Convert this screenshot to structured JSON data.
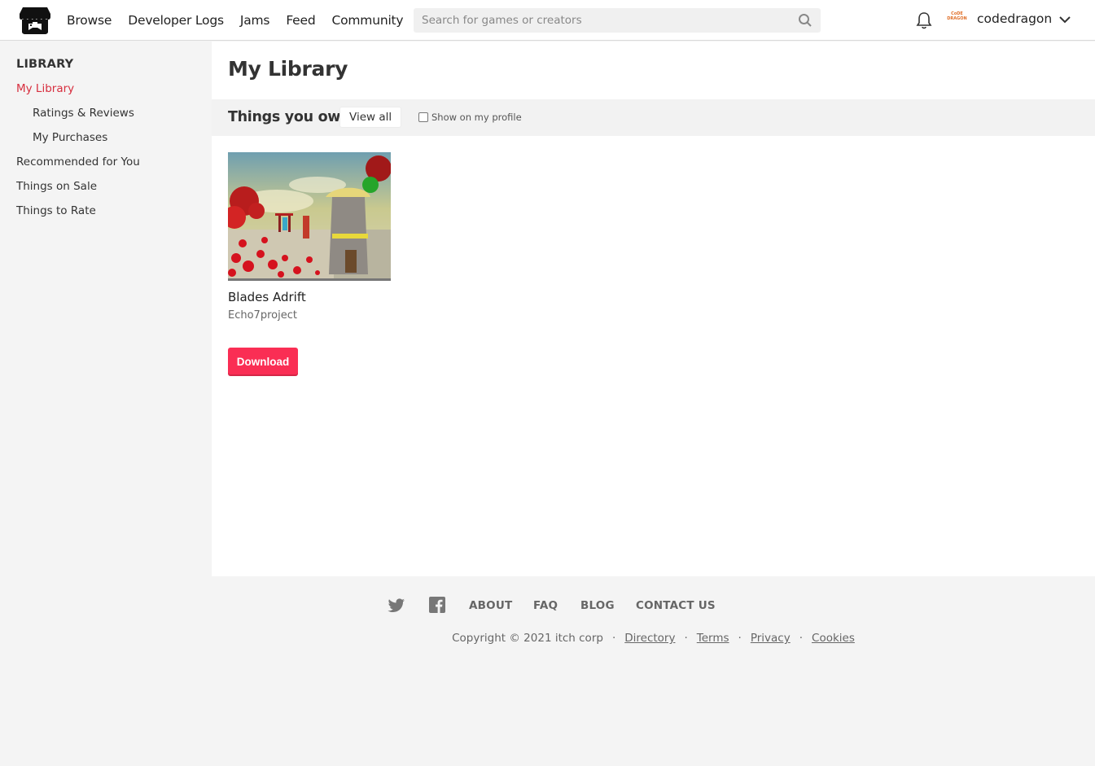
{
  "header": {
    "nav": [
      "Browse",
      "Developer Logs",
      "Jams",
      "Feed",
      "Community"
    ],
    "search_placeholder": "Search for games or creators",
    "avatar_text": "CoDE DRAGON",
    "username": "codedragon"
  },
  "sidebar": {
    "heading": "LIBRARY",
    "items": [
      {
        "label": "My Library",
        "active": true
      },
      {
        "label": "Ratings & Reviews"
      },
      {
        "label": "My Purchases"
      },
      {
        "label": "Recommended for You"
      },
      {
        "label": "Things on Sale"
      },
      {
        "label": "Things to Rate"
      }
    ]
  },
  "main": {
    "title": "My Library",
    "section_title": "Things you own",
    "view_all": "View all",
    "show_on_profile": "Show on my profile",
    "games": [
      {
        "title": "Blades Adrift",
        "author": "Echo7project",
        "action": "Download"
      }
    ]
  },
  "footer": {
    "links": [
      "ABOUT",
      "FAQ",
      "BLOG",
      "CONTACT US"
    ],
    "copyright": "Copyright © 2021 itch corp",
    "legal": [
      "Directory",
      "Terms",
      "Privacy",
      "Cookies"
    ]
  },
  "colors": {
    "accent": "#fa2e54",
    "active_link": "#d72e3e"
  }
}
